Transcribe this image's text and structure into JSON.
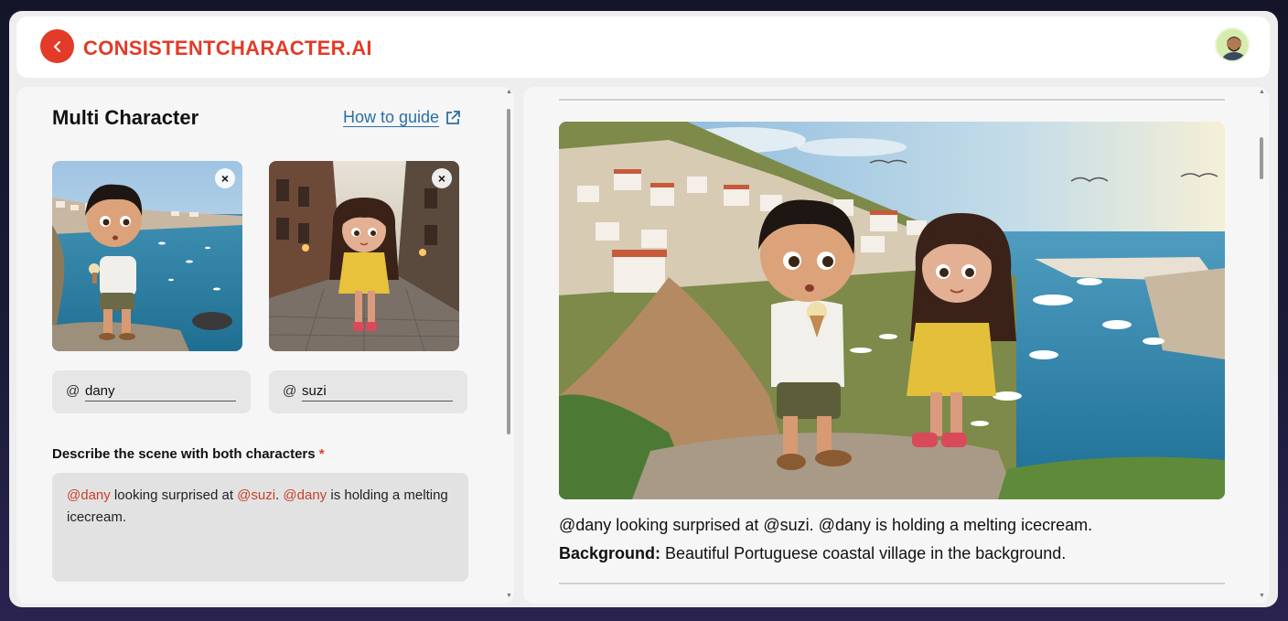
{
  "header": {
    "brand": "CONSISTENTCHARACTER.AI",
    "back_icon": "chevron-left-icon",
    "avatar_icon": "user-avatar"
  },
  "left": {
    "title": "Multi Character",
    "guide_label": "How to guide",
    "guide_icon": "external-link-icon",
    "characters": [
      {
        "name": "dany",
        "at": "@",
        "remove": "×"
      },
      {
        "name": "suzi",
        "at": "@",
        "remove": "×"
      }
    ],
    "scene_label": "Describe the scene with both characters",
    "required_mark": "*",
    "scene_parts": {
      "m1": "@dany",
      "t1": " looking surprised at ",
      "m2": "@suzi",
      "t2": ". ",
      "m3": "@dany",
      "t3": " is holding a melting icecream."
    }
  },
  "right": {
    "prompt": "@dany looking surprised at @suzi. @dany is holding a melting icecream.",
    "background_label": "Background:",
    "background_text": " Beautiful Portuguese coastal village in the background."
  },
  "colors": {
    "accent": "#e23b27",
    "link": "#2a6fa8",
    "mention": "#c8402a"
  }
}
